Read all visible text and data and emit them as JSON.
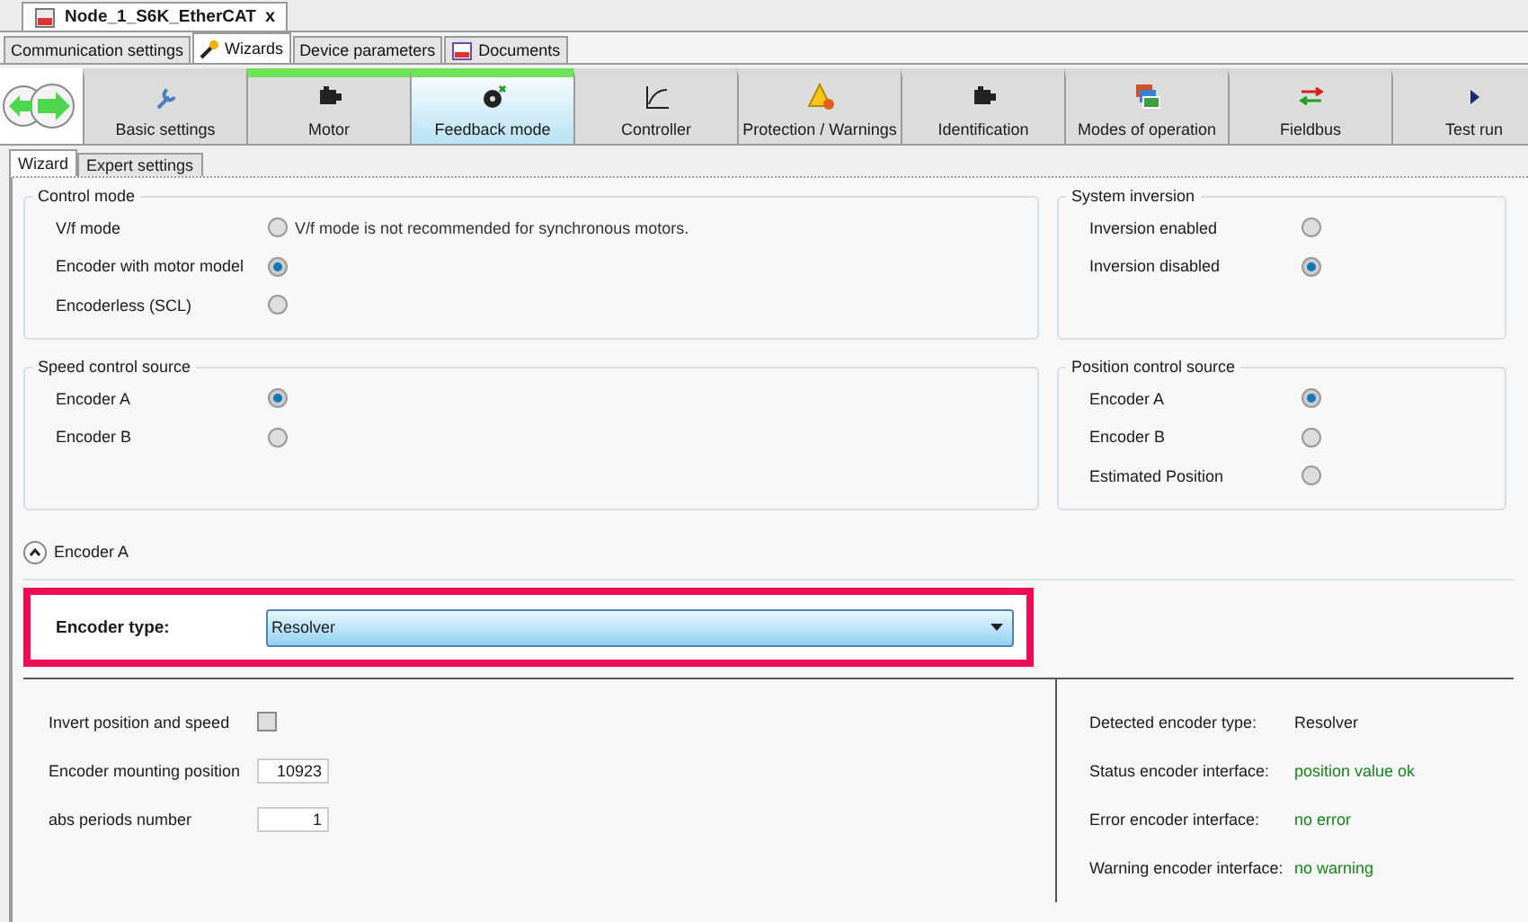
{
  "document_tab": {
    "title": "Node_1_S6K_EtherCAT",
    "close": "x"
  },
  "main_tabs": [
    {
      "label": "Communication settings",
      "selected": false,
      "kind": "plain"
    },
    {
      "label": "Wizards",
      "selected": true,
      "kind": "wand"
    },
    {
      "label": "Device parameters",
      "selected": false,
      "kind": "plain"
    },
    {
      "label": "Documents",
      "selected": false,
      "kind": "book"
    }
  ],
  "wizard_steps": [
    {
      "label": "Basic settings",
      "kind": "wrench",
      "completed": false,
      "selected": false
    },
    {
      "label": "Motor",
      "kind": "motor",
      "completed": true,
      "selected": false
    },
    {
      "label": "Feedback mode",
      "kind": "encoder",
      "completed": true,
      "selected": true
    },
    {
      "label": "Controller",
      "kind": "curve",
      "completed": false,
      "selected": false
    },
    {
      "label": "Protection / Warnings",
      "kind": "warning",
      "completed": false,
      "selected": false
    },
    {
      "label": "Identification",
      "kind": "motor",
      "completed": false,
      "selected": false
    },
    {
      "label": "Modes of operation",
      "kind": "windows",
      "completed": false,
      "selected": false
    },
    {
      "label": "Fieldbus",
      "kind": "arrows",
      "completed": false,
      "selected": false
    },
    {
      "label": "Test run",
      "kind": "play",
      "completed": false,
      "selected": false
    }
  ],
  "sub_tabs": [
    {
      "label": "Wizard",
      "selected": true
    },
    {
      "label": "Expert settings",
      "selected": false
    }
  ],
  "groups": [
    {
      "title": "Control mode",
      "options": [
        {
          "label": "V/f mode",
          "selected": false,
          "note": "V/f mode is not recommended for synchronous motors."
        },
        {
          "label": "Encoder with motor model",
          "selected": true
        },
        {
          "label": "Encoderless (SCL)",
          "selected": false
        }
      ]
    },
    {
      "title": "System inversion",
      "options": [
        {
          "label": "Inversion enabled",
          "selected": false
        },
        {
          "label": "Inversion disabled",
          "selected": true
        }
      ]
    },
    {
      "title": "Speed control source",
      "options": [
        {
          "label": "Encoder A",
          "selected": true
        },
        {
          "label": "Encoder B",
          "selected": false
        }
      ]
    },
    {
      "title": "Position control source",
      "options": [
        {
          "label": "Encoder A",
          "selected": true
        },
        {
          "label": "Encoder B",
          "selected": false
        },
        {
          "label": "Estimated Position",
          "selected": false
        }
      ]
    }
  ],
  "encoder_section": {
    "title": "Encoder A",
    "expanded": true,
    "type_label": "Encoder type:",
    "type_value": "Resolver",
    "highlighted": true,
    "parameters": [
      {
        "kind": "checkbox",
        "label": "Invert position and speed",
        "checked": false
      },
      {
        "kind": "number",
        "label": "Encoder mounting position",
        "value": "10923"
      },
      {
        "kind": "number",
        "label": "abs periods number",
        "value": "1"
      }
    ],
    "status": [
      {
        "label": "Detected encoder type:",
        "value": "Resolver",
        "color": "#1a1a1a"
      },
      {
        "label": "Status encoder interface:",
        "value": "position value ok",
        "color": "#15851a"
      },
      {
        "label": "Error encoder interface:",
        "value": "no error",
        "color": "#15851a"
      },
      {
        "label": "Warning encoder interface:",
        "value": "no warning",
        "color": "#15851a"
      }
    ]
  }
}
